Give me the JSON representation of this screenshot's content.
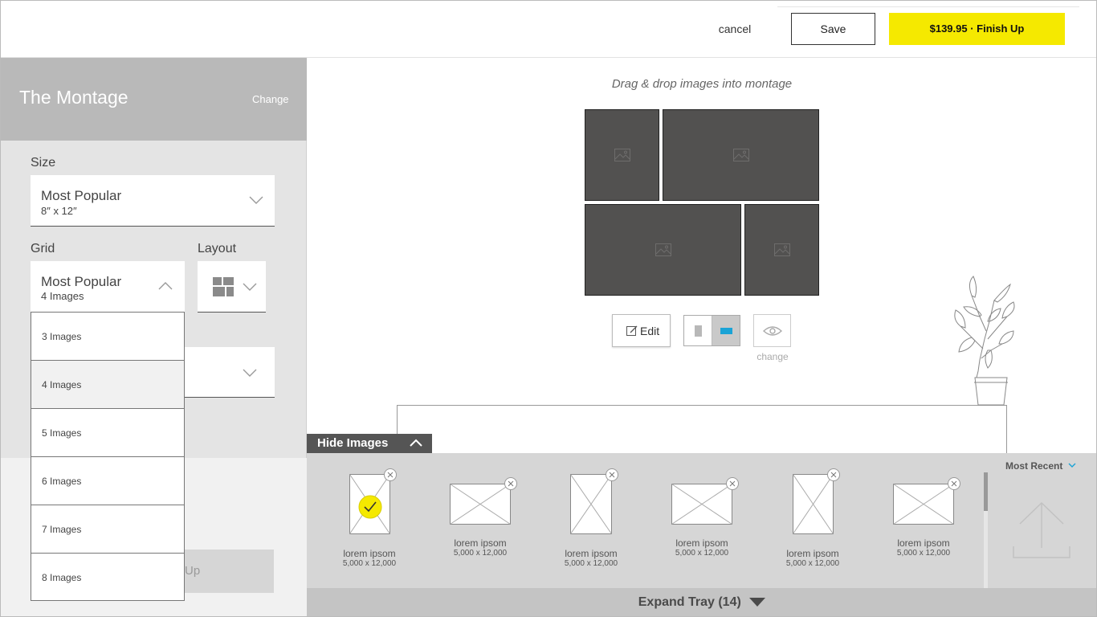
{
  "header": {
    "cancel_label": "cancel",
    "save_label": "Save",
    "finish_label": "$139.95 · Finish Up",
    "finish_color": "#f5e900"
  },
  "sidebar": {
    "title": "The Montage",
    "change_label": "Change",
    "size": {
      "label": "Size",
      "value": "Most Popular",
      "subvalue": "8″ x 12″"
    },
    "grid": {
      "label": "Grid",
      "value": "Most Popular",
      "subvalue": "4 Images",
      "options": [
        "3 Images",
        "4 Images",
        "5 Images",
        "6 Images",
        "7 Images",
        "8 Images"
      ],
      "selected_option": "4 Images"
    },
    "layout": {
      "label": "Layout",
      "icon": "layout-grid-icon"
    },
    "hidden_button_partial": "Up"
  },
  "canvas": {
    "hint": "Drag & drop images into montage",
    "slot_icon": "image-placeholder-icon",
    "edit_label": "Edit",
    "orientation": {
      "active": "landscape",
      "accent_color": "#1aa3d6"
    },
    "preview_change_label": "change"
  },
  "tray": {
    "hide_label": "Hide Images",
    "sort_label": "Most Recent",
    "expand_label": "Expand Tray (14)",
    "images": [
      {
        "name": "lorem ipsom",
        "size": "5,000 x 12,000",
        "orientation": "portrait",
        "selected": true
      },
      {
        "name": "lorem ipsom",
        "size": "5,000 x 12,000",
        "orientation": "landscape",
        "selected": false
      },
      {
        "name": "lorem ipsom",
        "size": "5,000 x 12,000",
        "orientation": "portrait",
        "selected": false
      },
      {
        "name": "lorem ipsom",
        "size": "5,000 x 12,000",
        "orientation": "landscape",
        "selected": false
      },
      {
        "name": "lorem ipsom",
        "size": "5,000 x 12,000",
        "orientation": "portrait",
        "selected": false
      },
      {
        "name": "lorem ipsom",
        "size": "5,000 x 12,000",
        "orientation": "landscape",
        "selected": false
      }
    ],
    "upload_icon": "upload-arrow-icon"
  }
}
